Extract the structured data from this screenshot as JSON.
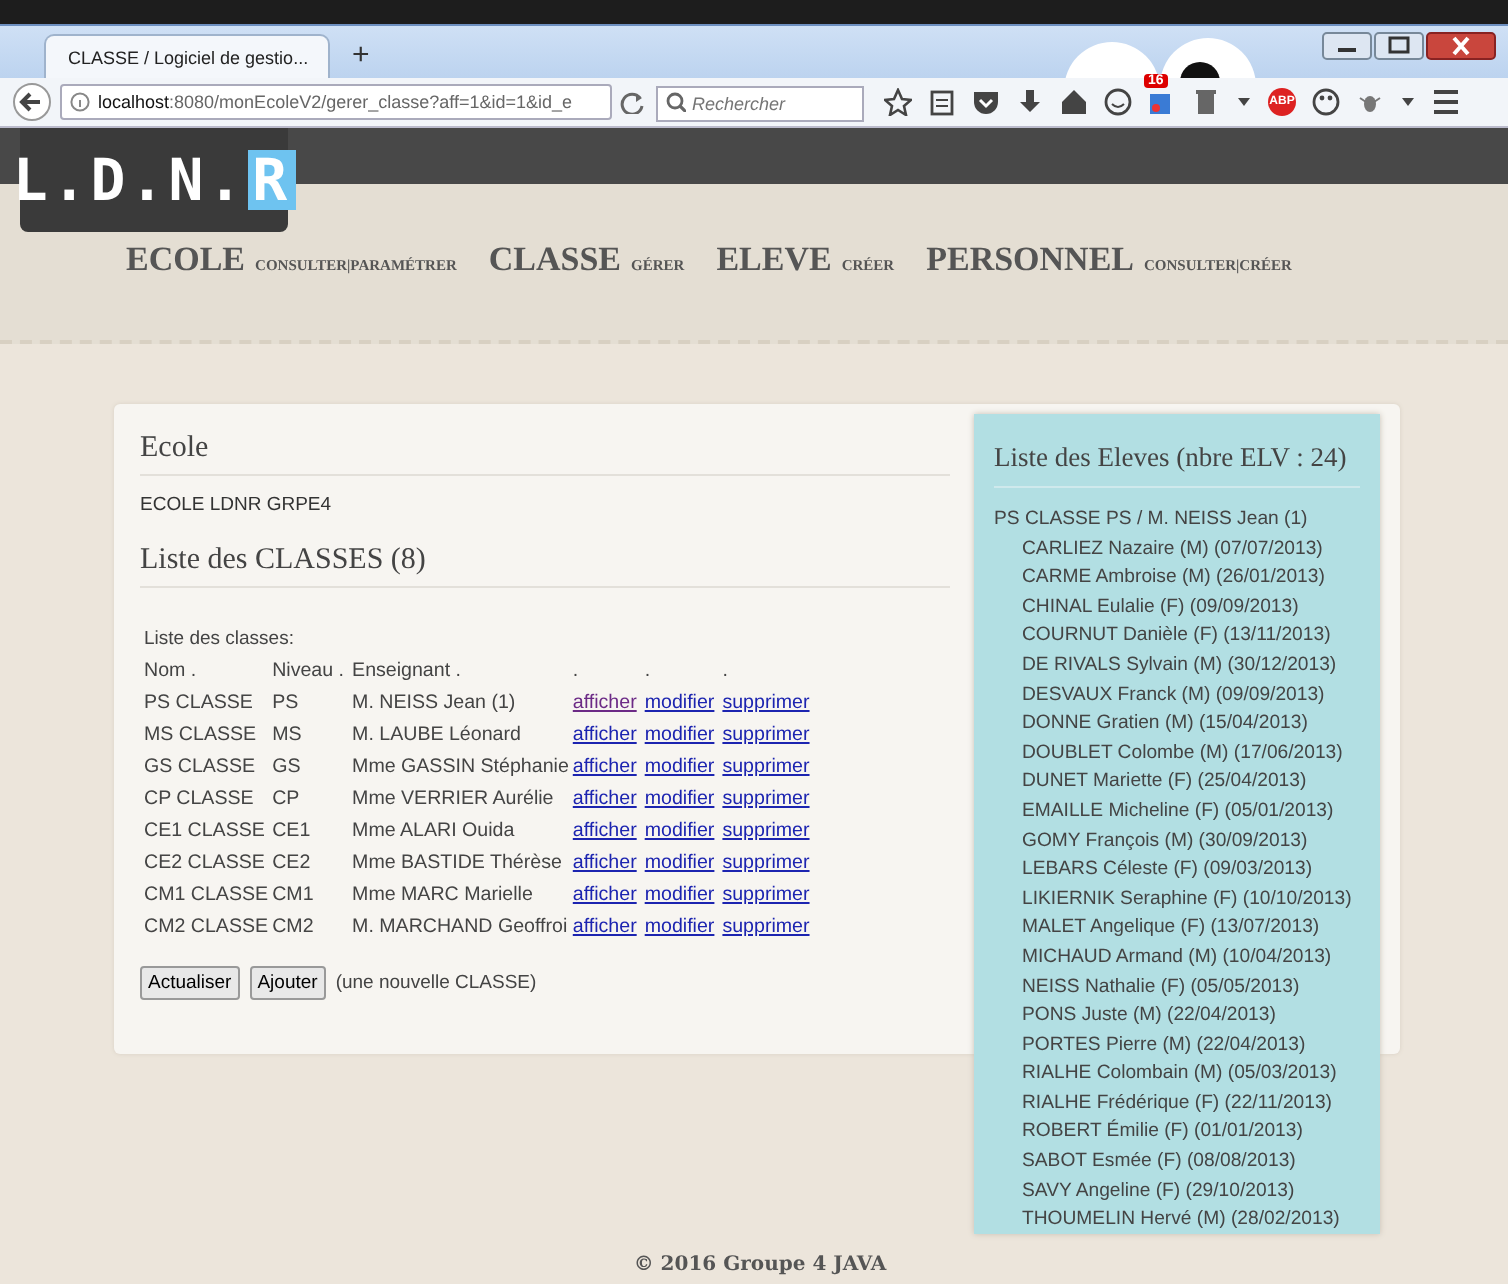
{
  "browser": {
    "tab_title": "CLASSE / Logiciel de gestio...",
    "new_tab": "+",
    "url_host": "localhost",
    "url_rest": ":8080/monEcoleV2/gerer_classe?aff=1&id=1&id_e",
    "search": {
      "placeholder": "Rechercher"
    },
    "badge": "16",
    "adblock": "ABP"
  },
  "site": {
    "logo": {
      "main": "L.D.N.",
      "accent": "R"
    },
    "nav": [
      {
        "label": "ECOLE",
        "sub": "CONSULTER|PARAMÉTRER"
      },
      {
        "label": "CLASSE",
        "sub": "GÉRER"
      },
      {
        "label": "ELEVE",
        "sub": "CRÉER"
      },
      {
        "label": "PERSONNEL",
        "sub": "CONSULTER|CRÉER"
      }
    ]
  },
  "main": {
    "school_heading": "Ecole",
    "school_name": "ECOLE LDNR GRPE4",
    "classes_heading": "Liste des CLASSES (8)",
    "table_caption": "Liste des classes:",
    "columns": [
      "Nom .",
      "Niveau .",
      "Enseignant .",
      ".",
      ".",
      "."
    ],
    "rows": [
      {
        "name": "PS CLASSE",
        "level": "PS",
        "teacher": "M. NEISS Jean (1)",
        "links": [
          {
            "label": "afficher",
            "visited": true
          },
          {
            "label": "modifier",
            "visited": false
          },
          {
            "label": "supprimer",
            "visited": false
          }
        ]
      },
      {
        "name": "MS CLASSE",
        "level": "MS",
        "teacher": "M. LAUBE Léonard",
        "links": [
          {
            "label": "afficher",
            "visited": false
          },
          {
            "label": "modifier",
            "visited": false
          },
          {
            "label": "supprimer",
            "visited": false
          }
        ]
      },
      {
        "name": "GS CLASSE",
        "level": "GS",
        "teacher": "Mme GASSIN Stéphanie",
        "links": [
          {
            "label": "afficher",
            "visited": false
          },
          {
            "label": "modifier",
            "visited": false
          },
          {
            "label": "supprimer",
            "visited": false
          }
        ]
      },
      {
        "name": "CP CLASSE",
        "level": "CP",
        "teacher": "Mme VERRIER Aurélie",
        "links": [
          {
            "label": "afficher",
            "visited": false
          },
          {
            "label": "modifier",
            "visited": false
          },
          {
            "label": "supprimer",
            "visited": false
          }
        ]
      },
      {
        "name": "CE1 CLASSE",
        "level": "CE1",
        "teacher": "Mme ALARI Ouida",
        "links": [
          {
            "label": "afficher",
            "visited": false
          },
          {
            "label": "modifier",
            "visited": false
          },
          {
            "label": "supprimer",
            "visited": false
          }
        ]
      },
      {
        "name": "CE2 CLASSE",
        "level": "CE2",
        "teacher": "Mme BASTIDE Thérèse",
        "links": [
          {
            "label": "afficher",
            "visited": false
          },
          {
            "label": "modifier",
            "visited": false
          },
          {
            "label": "supprimer",
            "visited": false
          }
        ]
      },
      {
        "name": "CM1 CLASSE",
        "level": "CM1",
        "teacher": "Mme MARC Marielle",
        "links": [
          {
            "label": "afficher",
            "visited": false
          },
          {
            "label": "modifier",
            "visited": false
          },
          {
            "label": "supprimer",
            "visited": false
          }
        ]
      },
      {
        "name": "CM2 CLASSE",
        "level": "CM2",
        "teacher": "M. MARCHAND Geoffroi",
        "links": [
          {
            "label": "afficher",
            "visited": false
          },
          {
            "label": "modifier",
            "visited": false
          },
          {
            "label": "supprimer",
            "visited": false
          }
        ]
      }
    ],
    "buttons": [
      "Actualiser",
      "Ajouter"
    ],
    "add_note": "(une nouvelle CLASSE)"
  },
  "students": {
    "heading": "Liste des Eleves (nbre ELV : 24)",
    "groups": [
      {
        "label": "PS CLASSE PS / M. NEISS Jean (1)",
        "children": [
          {
            "label": "CARLIEZ Nazaire (M) (07/07/2013)"
          },
          {
            "label": "CARME Ambroise (M) (26/01/2013)"
          },
          {
            "label": "CHINAL Eulalie (F) (09/09/2013)"
          },
          {
            "label": "COURNUT Danièle (F) (13/11/2013)"
          },
          {
            "label": "DE RIVALS Sylvain (M) (30/12/2013)"
          },
          {
            "label": "DESVAUX Franck (M) (09/09/2013)"
          },
          {
            "label": "DONNE Gratien (M) (15/04/2013)"
          },
          {
            "label": "DOUBLET Colombe (M) (17/06/2013)"
          },
          {
            "label": "DUNET Mariette (F) (25/04/2013)"
          },
          {
            "label": "EMAILLE Micheline (F) (05/01/2013)"
          },
          {
            "label": "GOMY François (M) (30/09/2013)"
          },
          {
            "label": "LEBARS Céleste (F) (09/03/2013)"
          },
          {
            "label": "LIKIERNIK Seraphine (F) (10/10/2013)"
          },
          {
            "label": "MALET Angelique (F) (13/07/2013)"
          },
          {
            "label": "MICHAUD Armand (M) (10/04/2013)"
          },
          {
            "label": "NEISS Nathalie (F) (05/05/2013)"
          },
          {
            "label": "PONS Juste (M) (22/04/2013)"
          },
          {
            "label": "PORTES Pierre (M) (22/04/2013)"
          },
          {
            "label": "RIALHE Colombain (M) (05/03/2013)"
          },
          {
            "label": "RIALHE Frédérique (F) (22/11/2013)"
          },
          {
            "label": "ROBERT Émilie (F) (01/01/2013)"
          },
          {
            "label": "SABOT Esmée (F) (08/08/2013)"
          },
          {
            "label": "SAVY Angeline (F) (29/10/2013)"
          },
          {
            "label": "THOUMELIN Hervé (M) (28/02/2013)"
          }
        ]
      }
    ]
  },
  "footer": "© 2016 Groupe 4 JAVA"
}
